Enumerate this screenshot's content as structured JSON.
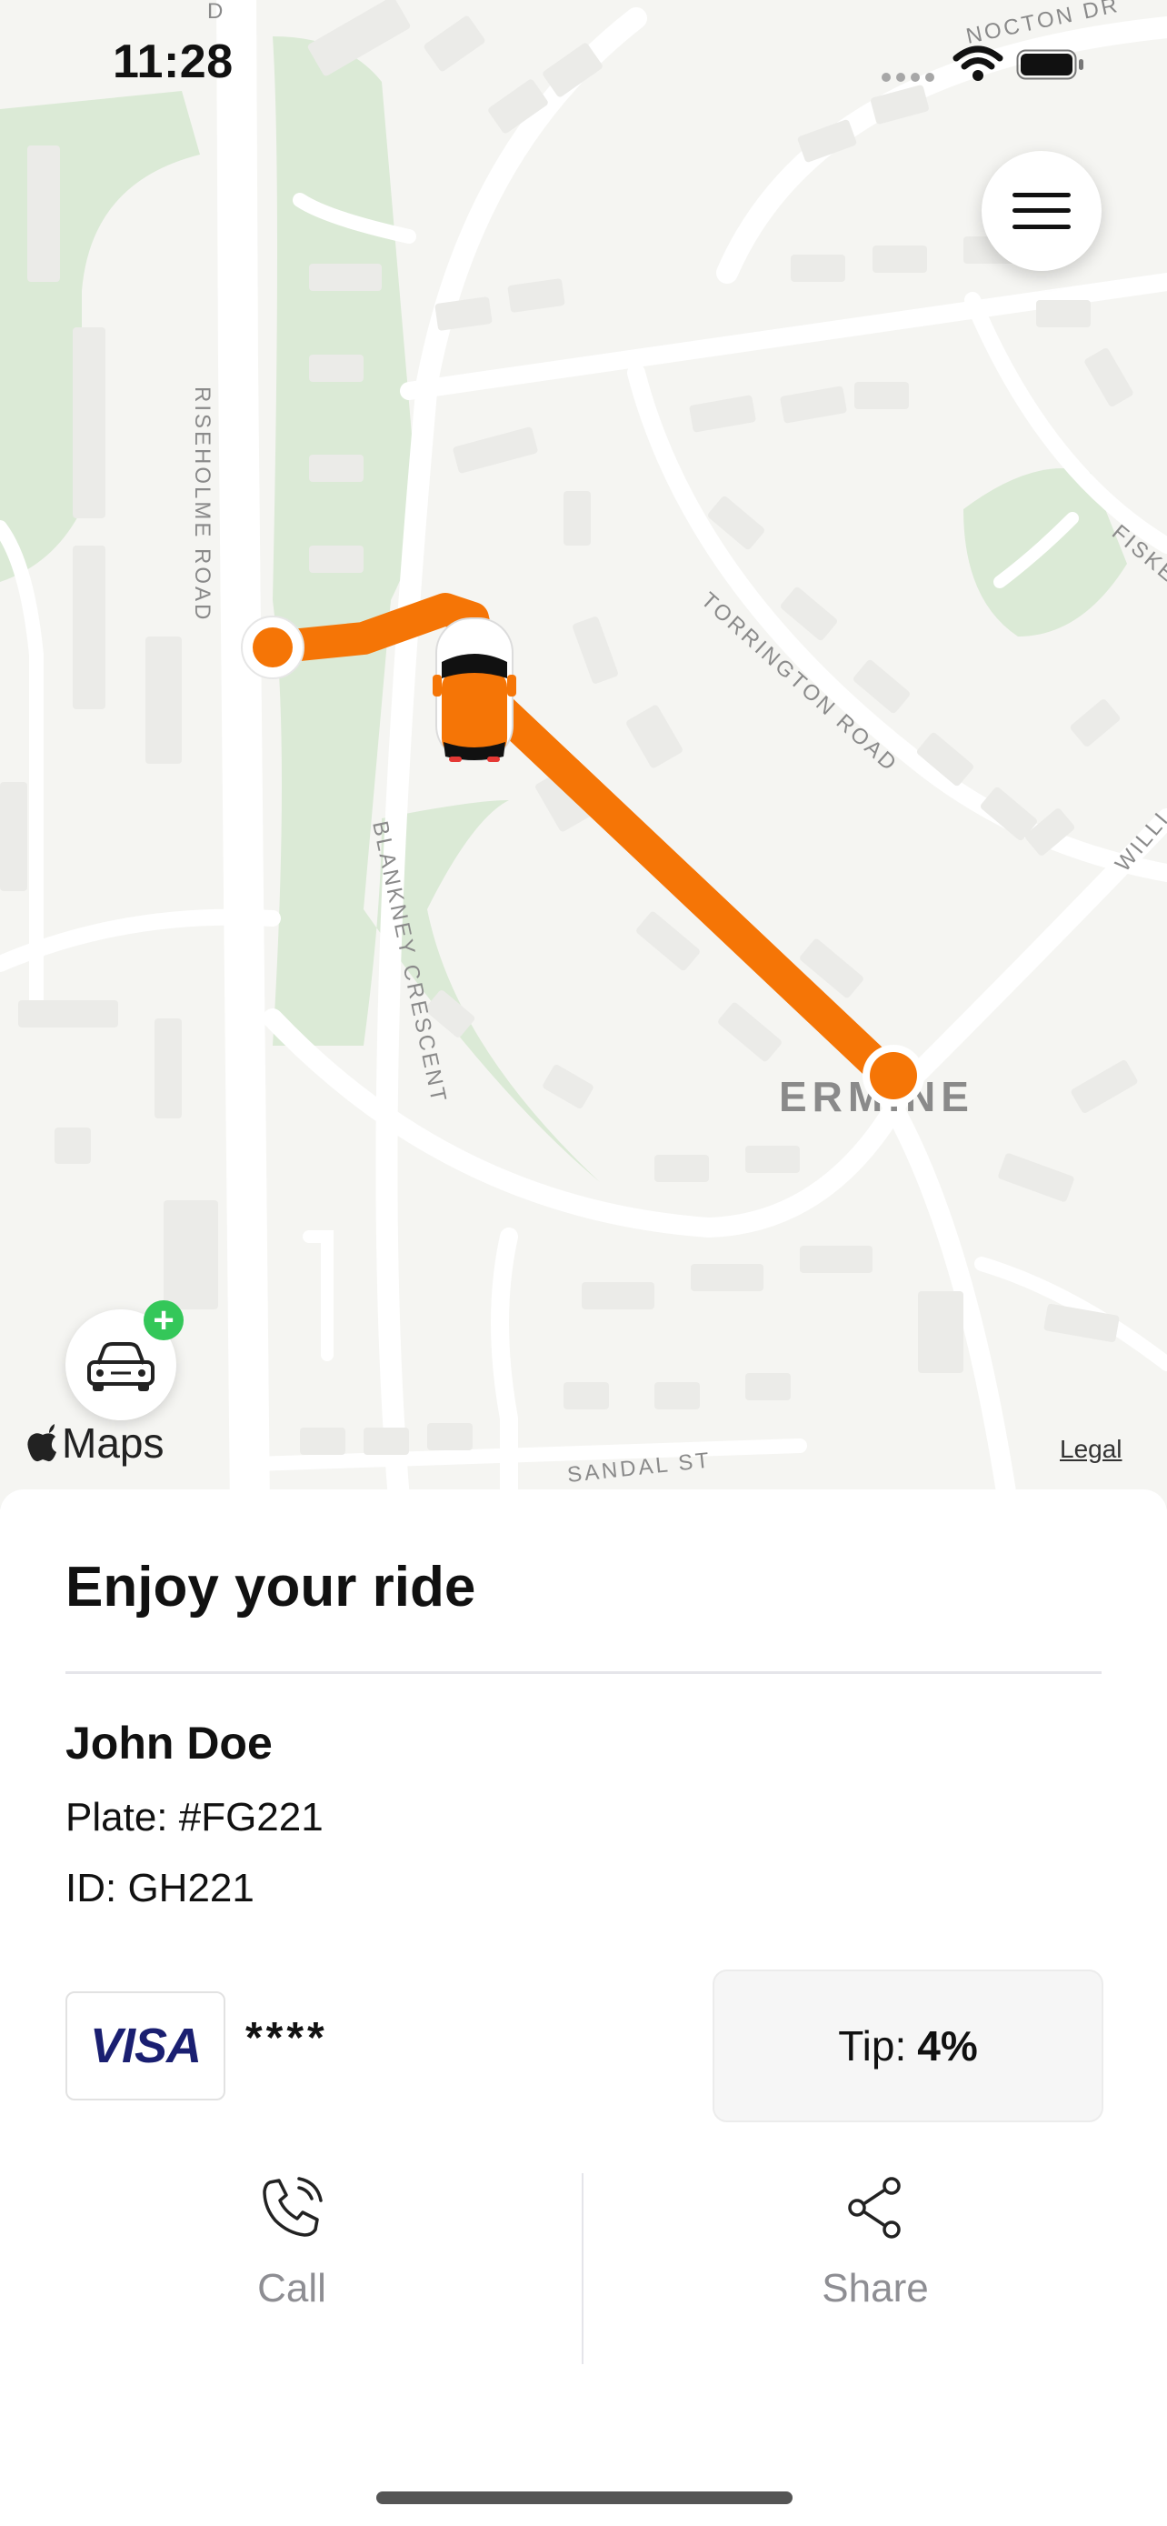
{
  "status_bar": {
    "time": "11:28"
  },
  "map": {
    "attribution": "Maps",
    "legal_label": "Legal",
    "street_labels": {
      "nocton_dr": "NOCTON DR",
      "riseholme_road": "RISEHOLME ROAD",
      "torrington_road": "TORRINGTON ROAD",
      "blankney_crescent": "BLANKNEY CRESCENT",
      "sandal_st": "SANDAL ST",
      "fiskerton": "FISKE",
      "willingham": "WILLI",
      "ermine": "ERMINE",
      "top_road": "D"
    },
    "route_color": "#f57506",
    "park_color": "#dbead6",
    "menu_icon": "hamburger-menu-icon",
    "car_button_icon": "car-icon",
    "badge_icon": "plus-icon",
    "badge_text": "+"
  },
  "ride": {
    "title": "Enjoy your ride",
    "driver_name": "John Doe",
    "plate": "Plate: #FG221",
    "id": "ID: GH221",
    "card_brand": "VISA",
    "card_digits": "****",
    "tip_label": "Tip:",
    "tip_value": "4%"
  },
  "actions": {
    "call_label": "Call",
    "call_icon": "phone-icon",
    "share_label": "Share",
    "share_icon": "share-icon"
  }
}
